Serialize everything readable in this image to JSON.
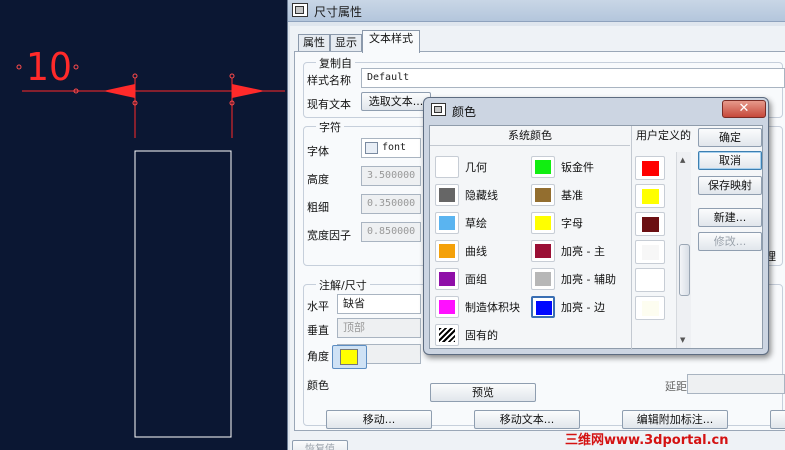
{
  "cad": {
    "dimension_text": "10"
  },
  "dialog": {
    "title": "尺寸属性",
    "tabs": [
      "属性",
      "显示",
      "文本样式"
    ],
    "copy_from": {
      "title": "复制自",
      "style_name_label": "样式名称",
      "style_name_value": "Default",
      "existing_text_label": "现有文本",
      "select_text_button": "选取文本..."
    },
    "chars": {
      "title": "字符",
      "font_label": "字体",
      "font_value": "font",
      "height_label": "高度",
      "height_value": "3.500000",
      "thickness_label": "粗细",
      "thickness_value": "0.350000",
      "width_factor_label": "宽度因子",
      "width_factor_value": "0.850000"
    },
    "note_dim": {
      "title": "注解/尺寸",
      "horizontal_label": "水平",
      "horizontal_value": "缺省",
      "vertical_label": "垂直",
      "vertical_value": "顶部",
      "angle_label": "角度",
      "color_label": "颜色",
      "color_value": "#ffff00"
    },
    "partial_right": {
      "mid_text": "理",
      "bottom_text": "延距"
    },
    "preview_button": "预览",
    "move_button": "移动...",
    "move_text_button": "移动文本...",
    "edit_attach_button": "编辑附加标注...",
    "restore_button": "恢复值"
  },
  "color_dialog": {
    "title": "颜色",
    "close_label": "✕",
    "system_colors_label": "系统颜色",
    "user_defined_label": "用户定义的",
    "system_colors": [
      {
        "label": "几何",
        "color": "#ffffff"
      },
      {
        "label": "钣金件",
        "color": "#11ee11"
      },
      {
        "label": "隐藏线",
        "color": "#666666"
      },
      {
        "label": "基准",
        "color": "#936e2f"
      },
      {
        "label": "草绘",
        "color": "#5ab4f0"
      },
      {
        "label": "字母",
        "color": "#ffff00"
      },
      {
        "label": "曲线",
        "color": "#f4a10a"
      },
      {
        "label": "加亮 - 主",
        "color": "#9a0f35"
      },
      {
        "label": "面组",
        "color": "#8f0fa8"
      },
      {
        "label": "加亮 - 辅助",
        "color": "#b7b7b7"
      },
      {
        "label": "制造体积块",
        "color": "#ff10ff"
      },
      {
        "label": "加亮 - 边",
        "color": "#0008ff"
      },
      {
        "label": "固有的",
        "color": "hatch"
      }
    ],
    "user_colors": [
      "#ff0000",
      "#ffff00",
      "#6b0f12",
      "#f7f7f7",
      "#ffffff",
      "#fdfdf0"
    ],
    "buttons": {
      "ok": "确定",
      "cancel": "取消",
      "save_map": "保存映射",
      "new": "新建...",
      "modify": "修改..."
    }
  },
  "watermark": "三维网www.3dportal.cn"
}
